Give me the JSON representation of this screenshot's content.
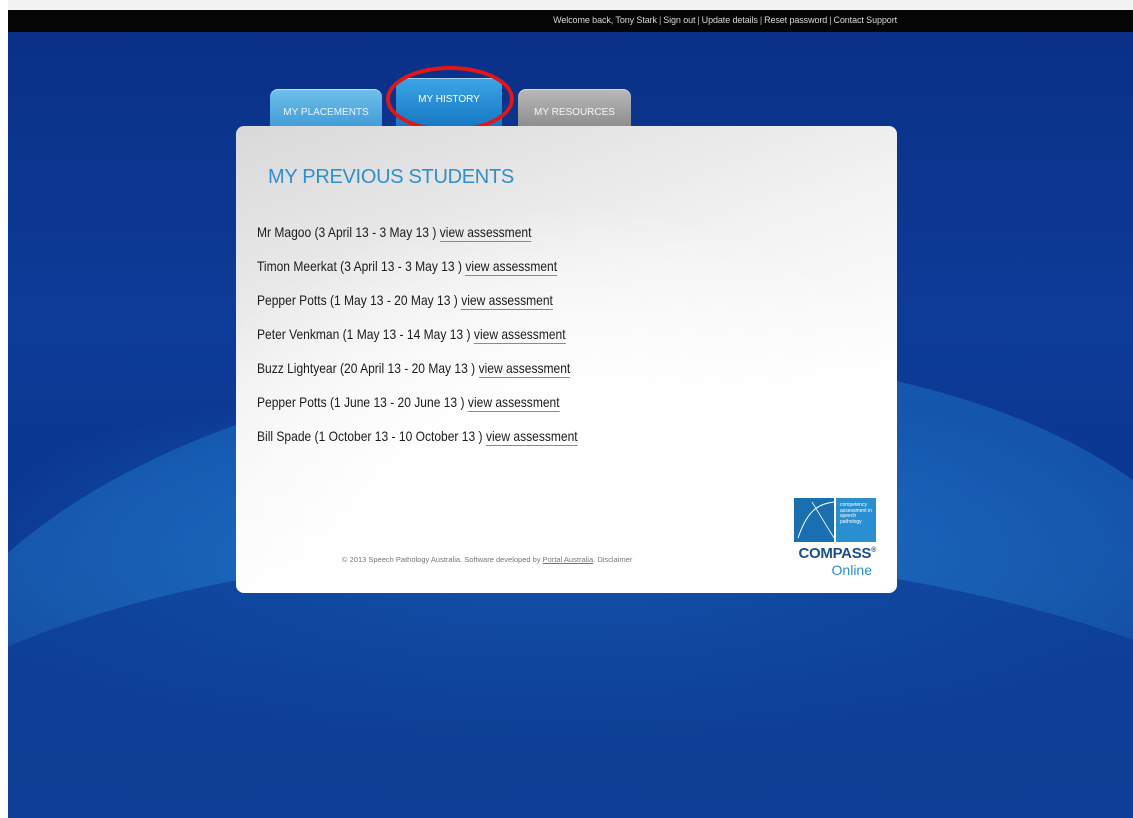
{
  "topbar": {
    "welcome": "Welcome back, Tony Stark",
    "links": [
      "Sign out",
      "Update details",
      "Reset password",
      "Contact Support"
    ]
  },
  "tabs": [
    {
      "label": "MY PLACEMENTS"
    },
    {
      "label": "MY HISTORY"
    },
    {
      "label": "MY RESOURCES"
    }
  ],
  "panel": {
    "title": "MY PREVIOUS STUDENTS",
    "link_label": "view assessment",
    "students": [
      {
        "text": "Mr Magoo (3 April 13 - 3 May 13 )"
      },
      {
        "text": "Timon Meerkat (3 April 13 - 3 May 13 )"
      },
      {
        "text": "Pepper Potts (1 May 13 - 20 May 13 )"
      },
      {
        "text": "Peter Venkman (1 May 13 - 14 May 13 )"
      },
      {
        "text": "Buzz Lightyear (20 April 13 - 20 May 13 )"
      },
      {
        "text": "Pepper Potts (1 June 13 - 20 June 13 )"
      },
      {
        "text": "Bill Spade (1 October 13 - 10 October 13 )"
      }
    ]
  },
  "footer": {
    "copyright": "© 2013 Speech Pathology Australia. Software developed by",
    "developer": "Portal Australia",
    "disclaimer": "Disclaimer"
  },
  "logo": {
    "tagline": "competency assessment in speech pathology",
    "word": "COMPASS",
    "reg": "®",
    "sub": "Online"
  },
  "colors": {
    "background": "#0b3a8f",
    "accent": "#2f8fce",
    "highlight": "#e11616"
  }
}
